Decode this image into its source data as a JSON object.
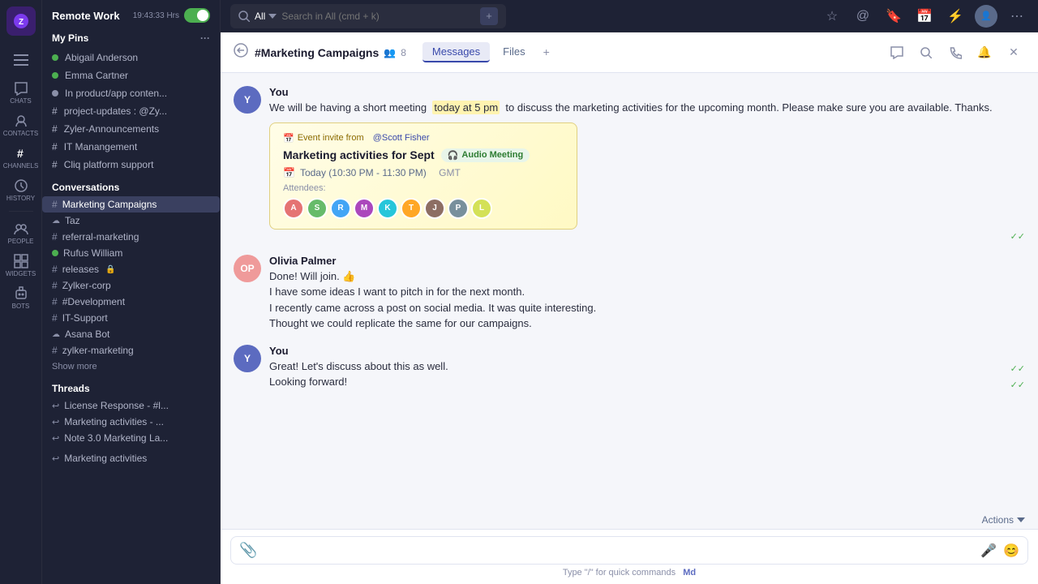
{
  "app": {
    "workspace": "Remote Work",
    "time": "19:43:33 Hrs",
    "status_active": true
  },
  "search": {
    "scope": "All",
    "placeholder": "Search in All (cmd + k)"
  },
  "nav_icons": [
    {
      "name": "menu-icon",
      "symbol": "☰"
    },
    {
      "name": "chats-icon",
      "label": "CHATS",
      "symbol": "💬"
    },
    {
      "name": "contacts-icon",
      "label": "CONTACTS",
      "symbol": "👥"
    },
    {
      "name": "channels-icon",
      "label": "CHANNELS",
      "symbol": "#"
    },
    {
      "name": "history-icon",
      "label": "HISTORY",
      "symbol": "🕒"
    },
    {
      "name": "people-icon",
      "label": "PEOPLE",
      "symbol": "👤"
    },
    {
      "name": "widgets-icon",
      "label": "WIDGETS",
      "symbol": "⊞"
    },
    {
      "name": "bots-icon",
      "label": "BOTS",
      "symbol": "🤖"
    }
  ],
  "sidebar": {
    "my_pins_label": "My Pins",
    "pins": [
      {
        "name": "Abigail Anderson",
        "online": true
      },
      {
        "name": "Emma Cartner",
        "online": true
      },
      {
        "name": "In product/app conten...",
        "online": false,
        "is_channel": true
      },
      {
        "name": "project-updates : @Zy...",
        "hash": true,
        "online": false
      },
      {
        "name": "Zyler-Announcements",
        "hash": true,
        "online": false
      },
      {
        "name": "IT Manangement",
        "hash": true,
        "online": false
      },
      {
        "name": "Cliq platform support",
        "hash": true,
        "online": false
      }
    ],
    "conversations_label": "Conversations",
    "conversations": [
      {
        "name": "Marketing Campaigns",
        "hash": true,
        "active": true
      },
      {
        "name": "Taz",
        "cloud": true
      },
      {
        "name": "referral-marketing",
        "hash": true
      },
      {
        "name": "Rufus William",
        "online": true
      },
      {
        "name": "releases",
        "hash": true,
        "lock": true
      },
      {
        "name": "Zylker-corp",
        "hash": true
      },
      {
        "name": "#Development",
        "hash": true
      },
      {
        "name": "IT-Support",
        "hash": true
      },
      {
        "name": "Asana Bot",
        "cloud": true
      },
      {
        "name": "zylker-marketing",
        "hash": true
      }
    ],
    "show_more": "Show more",
    "threads_label": "Threads",
    "threads": [
      {
        "name": "License Response - #l..."
      },
      {
        "name": "Marketing activities - ..."
      },
      {
        "name": "Note 3.0 Marketing La..."
      }
    ],
    "marketing_activities_label": "Marketing activities"
  },
  "channel": {
    "name": "#Marketing Campaigns",
    "member_count": "8",
    "tabs": [
      "Messages",
      "Files"
    ],
    "active_tab": "Messages"
  },
  "messages": [
    {
      "id": "msg1",
      "author": "You",
      "avatar_color": "#5c6bc0",
      "avatar_initials": "Y",
      "text": "We will be having a short meeting  today at 5 pm  to discuss the marketing activities for the upcoming month. Please make sure you are available. Thanks.",
      "highlight_texts": [
        "today at 5 pm"
      ],
      "has_event": true,
      "event": {
        "from_label": "Event invite from",
        "from_user": "@Scott Fisher",
        "title": "Marketing activities for Sept",
        "audio_badge": "🎧 Audio Meeting",
        "time_label": "Today (10:30 PM - 11:30 PM)",
        "timezone": "GMT",
        "attendees_label": "Attendees:",
        "attendees": [
          {
            "color": "#e57373",
            "initials": "A"
          },
          {
            "color": "#66bb6a",
            "initials": "S"
          },
          {
            "color": "#42a5f5",
            "initials": "R"
          },
          {
            "color": "#ab47bc",
            "initials": "M"
          },
          {
            "color": "#26c6da",
            "initials": "K"
          },
          {
            "color": "#ffa726",
            "initials": "T"
          },
          {
            "color": "#8d6e63",
            "initials": "J"
          },
          {
            "color": "#78909c",
            "initials": "P"
          },
          {
            "color": "#d4e157",
            "initials": "L"
          }
        ]
      },
      "tick": "✓✓"
    },
    {
      "id": "msg2",
      "author": "Olivia Palmer",
      "avatar_color": "#ef9a9a",
      "avatar_initials": "OP",
      "lines": [
        "Done! Will join. 👍",
        "I have some ideas I want to pitch in for the next month.",
        "I recently came across a post on social media. It was quite interesting.",
        "Thought we could replicate the same for our campaigns."
      ]
    },
    {
      "id": "msg3",
      "author": "You",
      "avatar_color": "#5c6bc0",
      "avatar_initials": "Y",
      "lines": [
        "Great! Let's discuss about this as well.",
        "Looking forward!"
      ],
      "ticks": [
        "✓✓",
        "✓✓"
      ]
    }
  ],
  "actions_label": "Actions",
  "input": {
    "placeholder": "",
    "hint": "Type \"/\" for quick commands",
    "markdown_hint": "Md"
  }
}
